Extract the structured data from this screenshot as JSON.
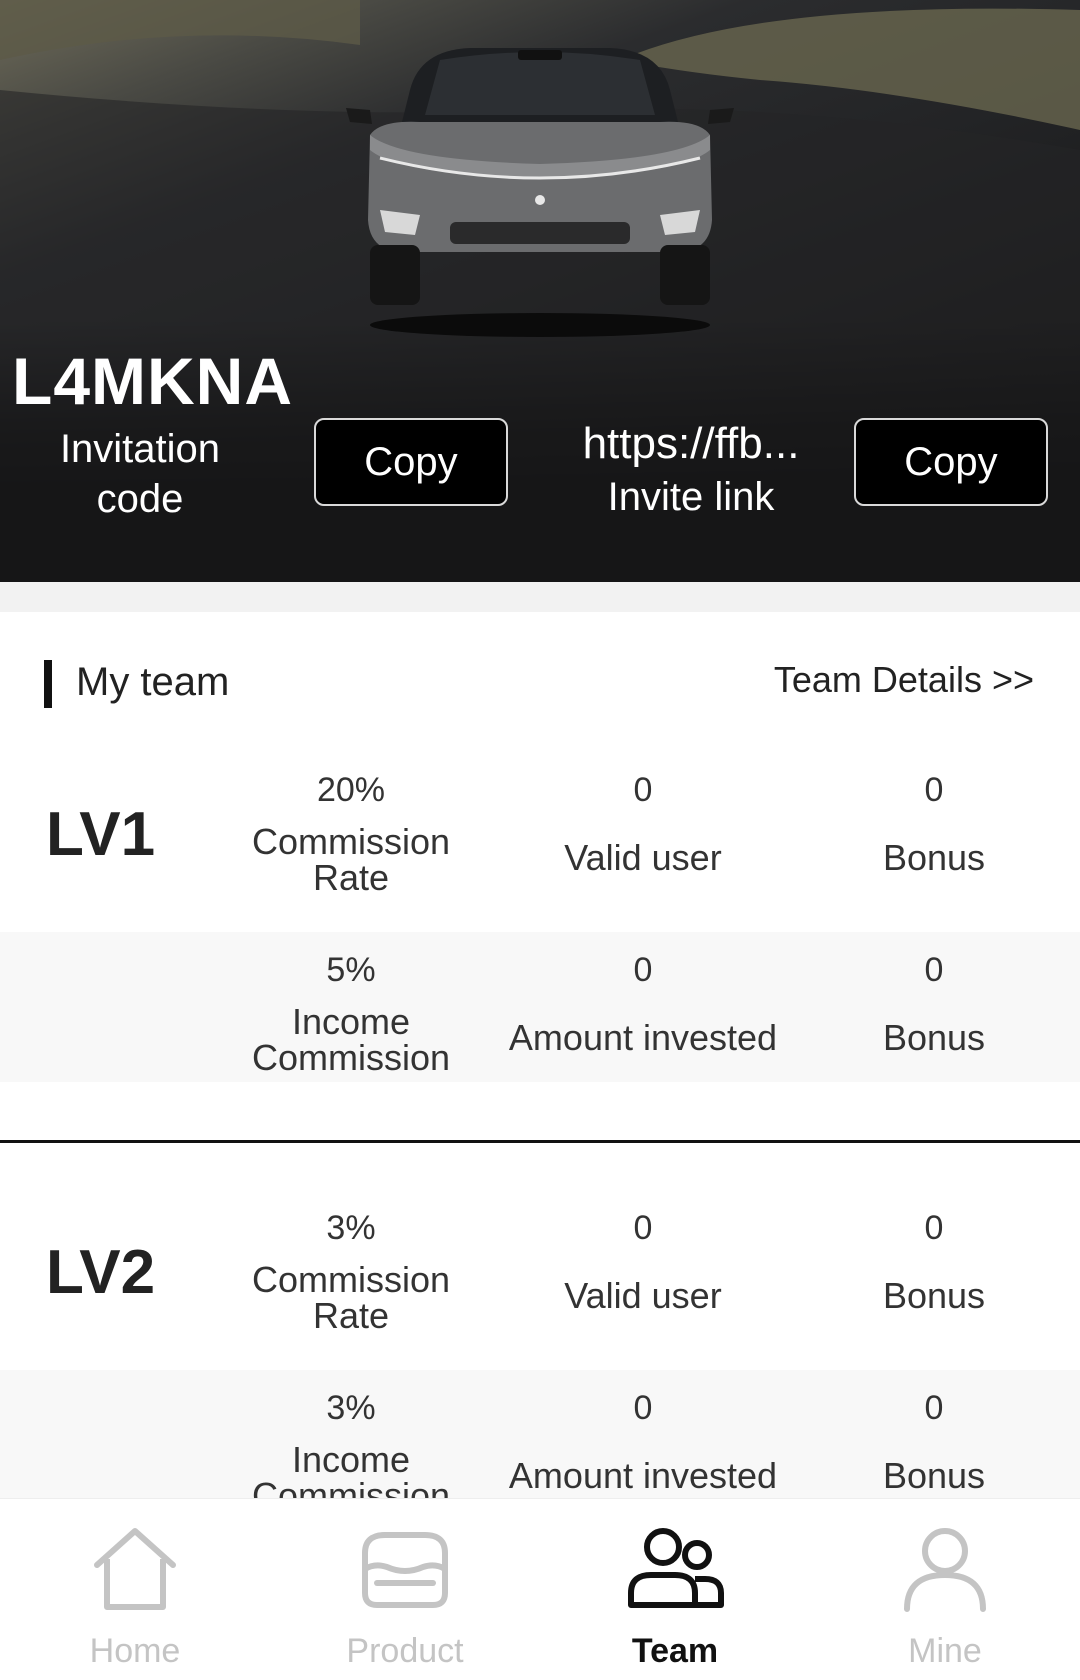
{
  "hero": {
    "invitation_code": "L4MKNA",
    "invitation_code_label_line1": "Invitation",
    "invitation_code_label_line2": "code",
    "copy_code_label": "Copy",
    "invite_link": "https://ffb...",
    "invite_link_label": "Invite link",
    "copy_link_label": "Copy"
  },
  "team": {
    "title": "My team",
    "details_link": "Team Details >>"
  },
  "levels": [
    {
      "label": "LV1",
      "rows": [
        {
          "c1_value": "20%",
          "c1_line1": "Commission",
          "c1_line2": "Rate",
          "c2_value": "0",
          "c2_label": "Valid user",
          "c3_value": "0",
          "c3_label": "Bonus"
        },
        {
          "c1_value": "5%",
          "c1_line1": "Income",
          "c1_line2": "Commission",
          "c2_value": "0",
          "c2_label": "Amount invested",
          "c3_value": "0",
          "c3_label": "Bonus"
        }
      ]
    },
    {
      "label": "LV2",
      "rows": [
        {
          "c1_value": "3%",
          "c1_line1": "Commission",
          "c1_line2": "Rate",
          "c2_value": "0",
          "c2_label": "Valid user",
          "c3_value": "0",
          "c3_label": "Bonus"
        },
        {
          "c1_value": "3%",
          "c1_line1": "Income",
          "c1_line2": "Commission",
          "c2_value": "0",
          "c2_label": "Amount invested",
          "c3_value": "0",
          "c3_label": "Bonus"
        }
      ]
    }
  ],
  "tabs": [
    {
      "label": "Home",
      "icon": "home-icon",
      "active": false
    },
    {
      "label": "Product",
      "icon": "car-icon",
      "active": false
    },
    {
      "label": "Team",
      "icon": "team-icon",
      "active": true
    },
    {
      "label": "Mine",
      "icon": "user-icon",
      "active": false
    }
  ],
  "colors": {
    "active_tab": "#111111",
    "inactive_tab": "#c4c4c4",
    "hero_bg": "#000000"
  }
}
